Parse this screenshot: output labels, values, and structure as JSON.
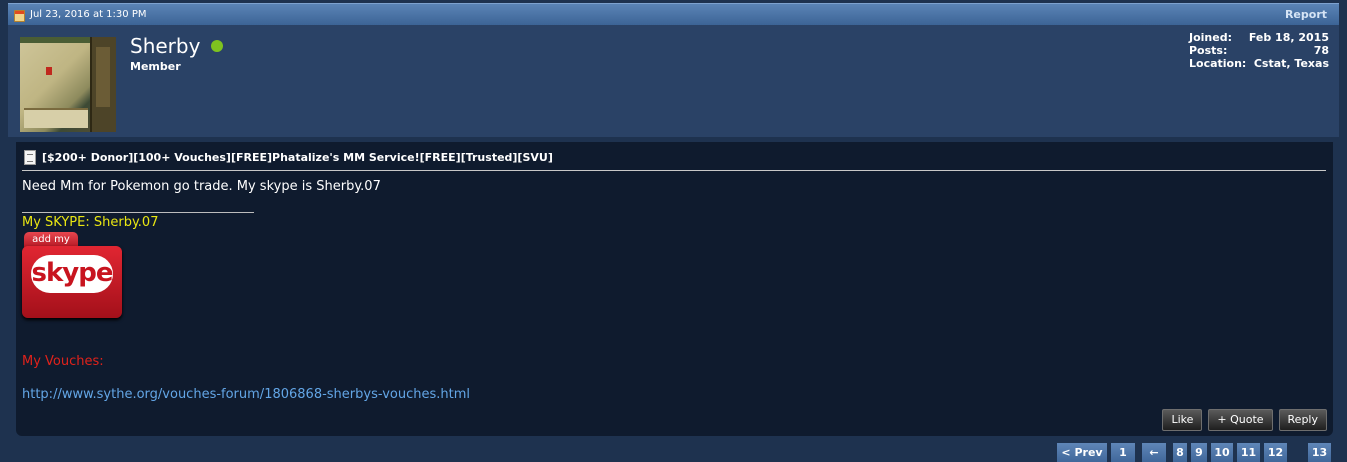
{
  "post": {
    "date": "Jul 23, 2016 at 1:30 PM",
    "report_label": "Report"
  },
  "user": {
    "name": "Sherby",
    "title": "Member",
    "online_color": "#7ec31f",
    "stats": [
      {
        "label": "Joined:",
        "value": "Feb 18, 2015"
      },
      {
        "label": "Posts:",
        "value": "78"
      },
      {
        "label": "Location:",
        "value": "Cstat, Texas"
      }
    ]
  },
  "thread": {
    "title": "[$200+ Donor][100+ Vouches][FREE]Phatalize's MM Service![FREE][Trusted][SVU]",
    "icon": "document-icon"
  },
  "message": {
    "text": "Need Mm for Pokemon go trade. My skype is Sherby.07"
  },
  "signature": {
    "skype_text": "My SKYPE: Sherby.07",
    "badge_tab": "add my",
    "badge_logo": "skype",
    "vouches_label": "My Vouches:",
    "vouches_link": "http://www.sythe.org/vouches-forum/1806868-sherbys-vouches.html"
  },
  "actions": {
    "like": "Like",
    "quote": "+ Quote",
    "reply": "Reply"
  },
  "pagination": {
    "prev": "< Prev",
    "first": "1",
    "arrow": "←",
    "pages": [
      "8",
      "9",
      "10",
      "11",
      "12"
    ],
    "last": "13"
  },
  "colors": {
    "accent": "#5b84b6",
    "link": "#63a6e6",
    "signature_yellow": "#e9e612",
    "vouches_red": "#e0221b"
  }
}
